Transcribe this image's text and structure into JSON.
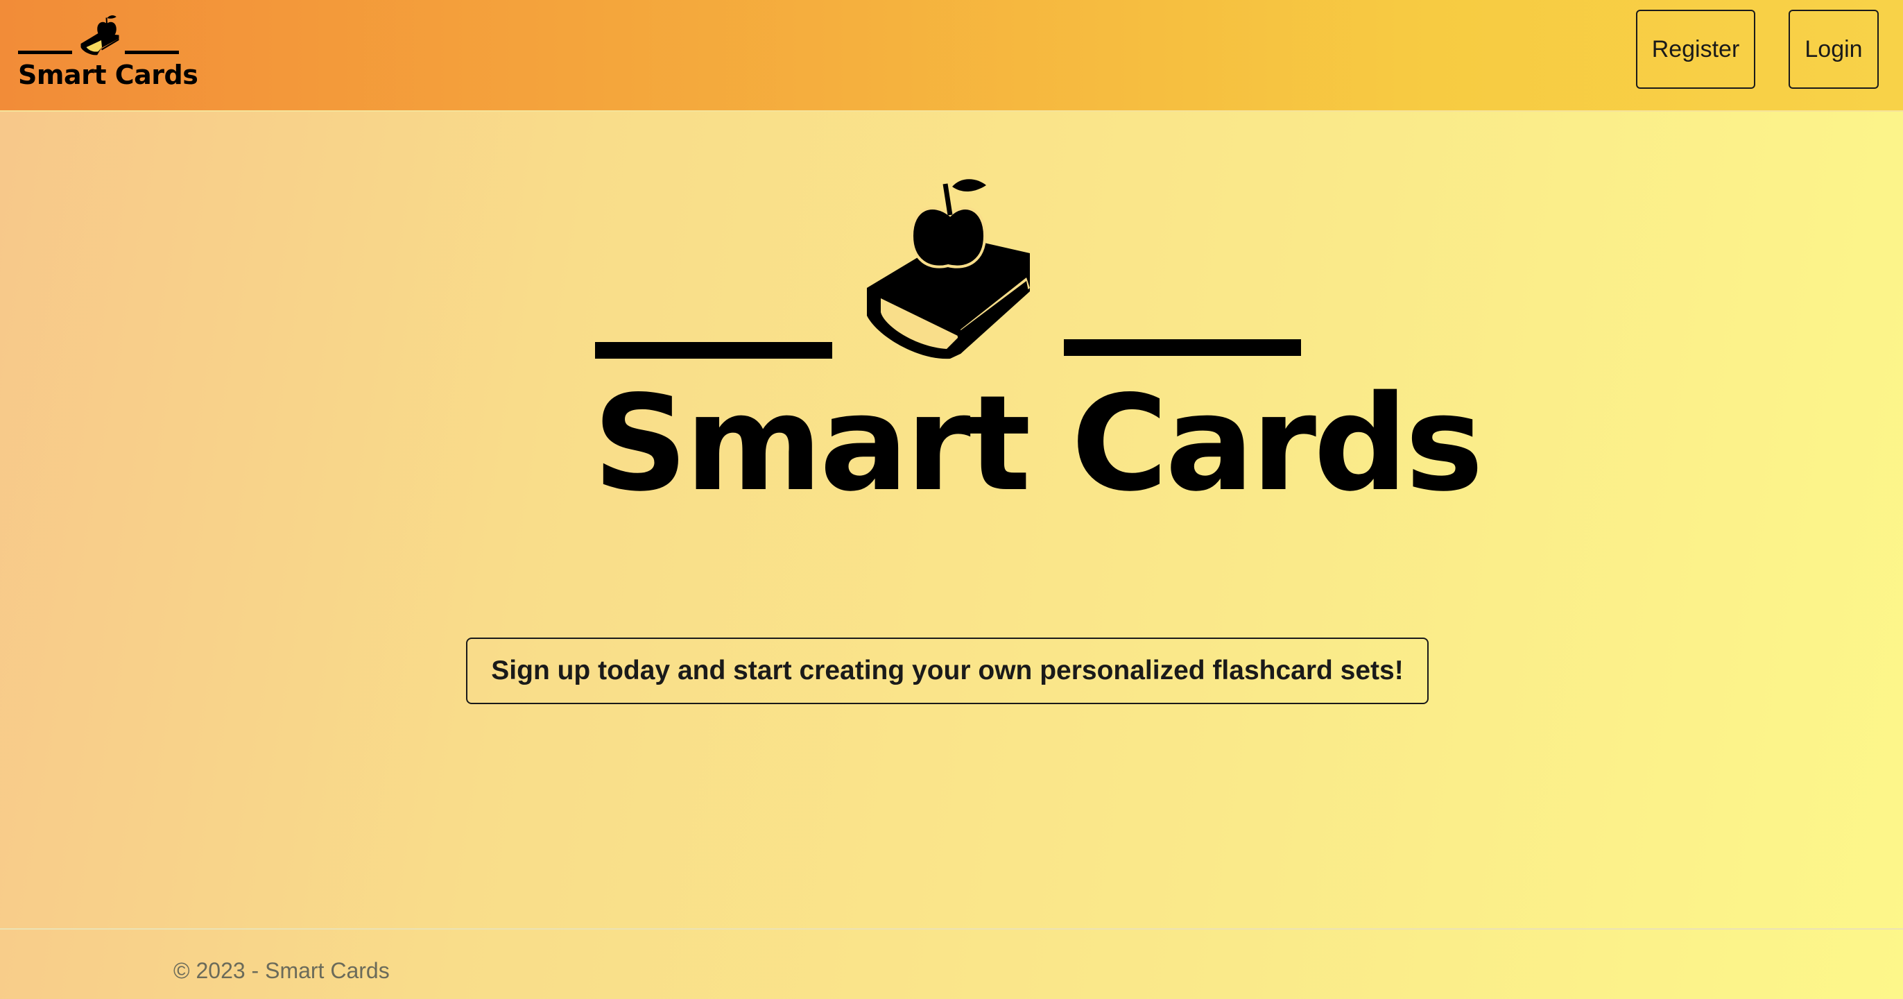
{
  "navbar": {
    "brand_label": "Smart Cards",
    "register_label": "Register",
    "login_label": "Login"
  },
  "hero": {
    "title": "Smart Cards",
    "cta_label": "Sign up today and start creating your own personalized flashcard sets!"
  },
  "footer": {
    "copyright": "© 2023 - Smart Cards"
  },
  "icons": {
    "brand": "apple-on-book-icon",
    "hero": "apple-on-book-icon"
  },
  "colors": {
    "navbar_start": "#f28c38",
    "navbar_end": "#f8d248",
    "background_start": "#f7c78a",
    "background_end": "#fdf78a",
    "text": "#000000",
    "footer_text": "#6b6b5a"
  }
}
